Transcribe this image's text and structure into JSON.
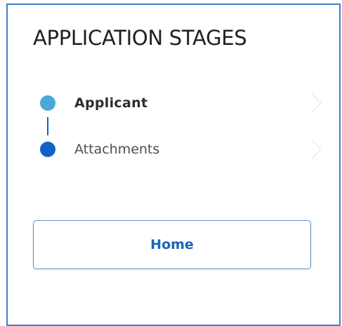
{
  "panel": {
    "title": "APPLICATION STAGES"
  },
  "stages": [
    {
      "label": "Applicant",
      "state": "current",
      "dot_color": "#4aa8d8",
      "icon": "chevron-right-icon"
    },
    {
      "label": "Attachments",
      "state": "pending",
      "dot_color": "#1261c8",
      "icon": "chevron-right-icon"
    }
  ],
  "connector_color": "#1261c8",
  "home_button": {
    "label": "Home"
  },
  "colors": {
    "panel_border": "#3d7fc9",
    "button_border": "#5b8fcf",
    "button_text": "#1c64b8"
  }
}
